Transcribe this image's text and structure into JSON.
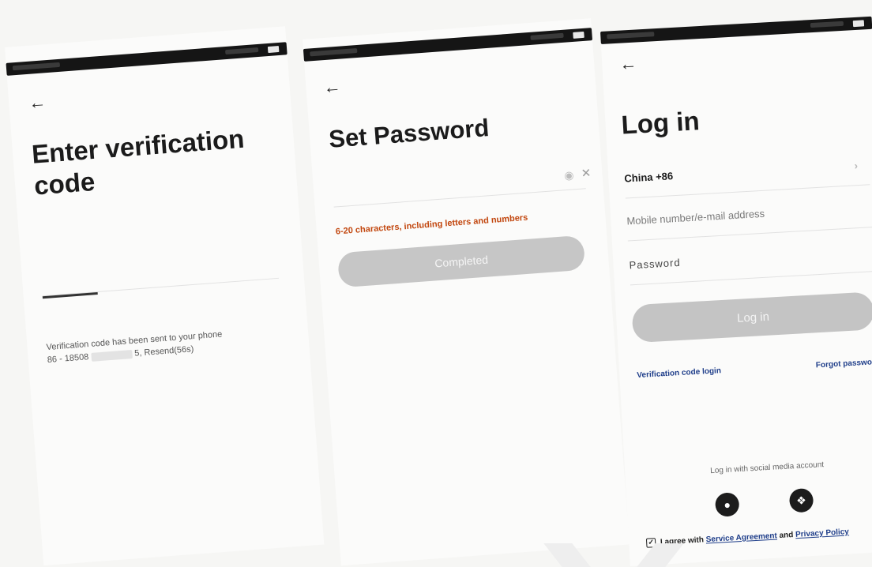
{
  "verification_screen": {
    "title": "Enter verification code",
    "notice_prefix": "Verification code has been sent to your phone",
    "notice_line2_prefix": "86 - 18508",
    "notice_line2_suffix": "5, Resend(56s)"
  },
  "password_screen": {
    "title": "Set Password",
    "hint": "6-20 characters, including letters and numbers",
    "completed_label": "Completed"
  },
  "login_screen": {
    "title": "Log in",
    "country": "China +86",
    "mobile_placeholder": "Mobile number/e-mail address",
    "password_placeholder": "Password",
    "login_label": "Log in",
    "verification_login_label": "Verification code login",
    "forgot_password_label": "Forgot password",
    "social_label": "Log in with social media account",
    "agree_prefix": "I agree with",
    "service_agreement": "Service Agreement",
    "agree_and": "and",
    "privacy_policy": "Privacy Policy"
  },
  "icons": {
    "back": "back-arrow-icon",
    "eye": "eye-icon",
    "clear": "clear-icon",
    "chevron": "chevron-right-icon",
    "qq": "qq-icon",
    "wechat": "wechat-icon",
    "checkbox": "checkbox-checked-icon"
  },
  "colors": {
    "hint_orange": "#c2470f",
    "link_blue": "#1f3e8a",
    "disabled_button": "#c6c6c6"
  }
}
